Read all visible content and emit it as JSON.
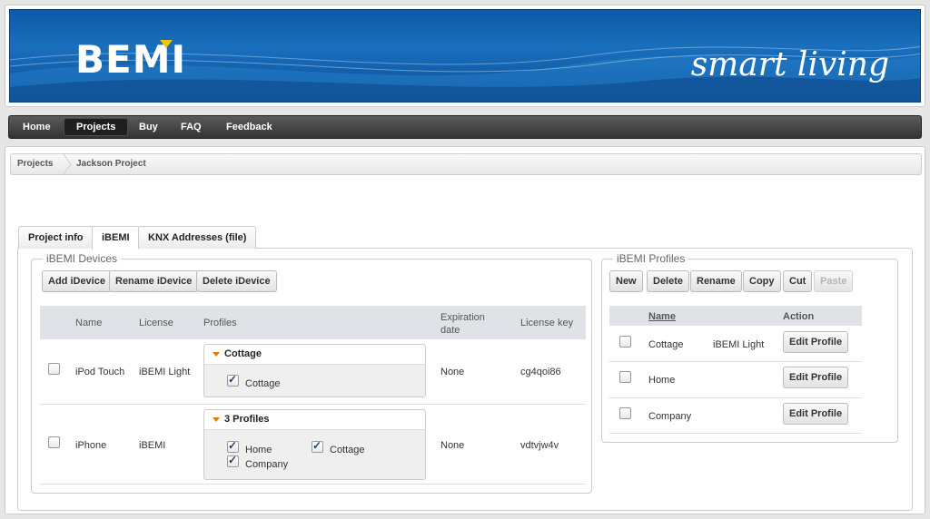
{
  "banner": {
    "logo": "BEMI",
    "tagline": "smart living"
  },
  "nav": [
    "Home",
    "Projects",
    "Buy",
    "FAQ",
    "Feedback"
  ],
  "breadcrumb": [
    "Projects",
    "Jackson Project"
  ],
  "tabs": [
    "Project info",
    "iBEMI",
    "KNX Addresses (file)"
  ],
  "devices": {
    "legend": "iBEMI Devices",
    "buttons": [
      "Add iDevice",
      "Rename iDevice",
      "Delete iDevice"
    ],
    "columns": [
      "Name",
      "License",
      "Profiles",
      "Expiration date",
      "License key"
    ],
    "rows": [
      {
        "name": "iPod Touch",
        "license": "iBEMI Light",
        "profile_title": "Cottage",
        "profiles": [
          "Cottage"
        ],
        "expiration": "None",
        "key": "cg4qoi86"
      },
      {
        "name": "iPhone",
        "license": "iBEMI",
        "profile_title": "3 Profiles",
        "profiles": [
          "Home",
          "Cottage",
          "Company"
        ],
        "expiration": "None",
        "key": "vdtvjw4v"
      }
    ]
  },
  "profiles": {
    "legend": "iBEMI Profiles",
    "buttons": [
      "New",
      "Delete",
      "Rename",
      "Copy",
      "Cut",
      "Paste"
    ],
    "columns": [
      "Name",
      "Action"
    ],
    "rows": [
      {
        "name": "Cottage",
        "license": "iBEMI Light",
        "action": "Edit Profile"
      },
      {
        "name": "Home",
        "license": "",
        "action": "Edit Profile"
      },
      {
        "name": "Company",
        "license": "",
        "action": "Edit Profile"
      }
    ]
  },
  "colors": {
    "banner": "#0b5aa6",
    "accent": "#f5c400",
    "nav": "#333333",
    "profile_arrow": "#e07b00"
  }
}
